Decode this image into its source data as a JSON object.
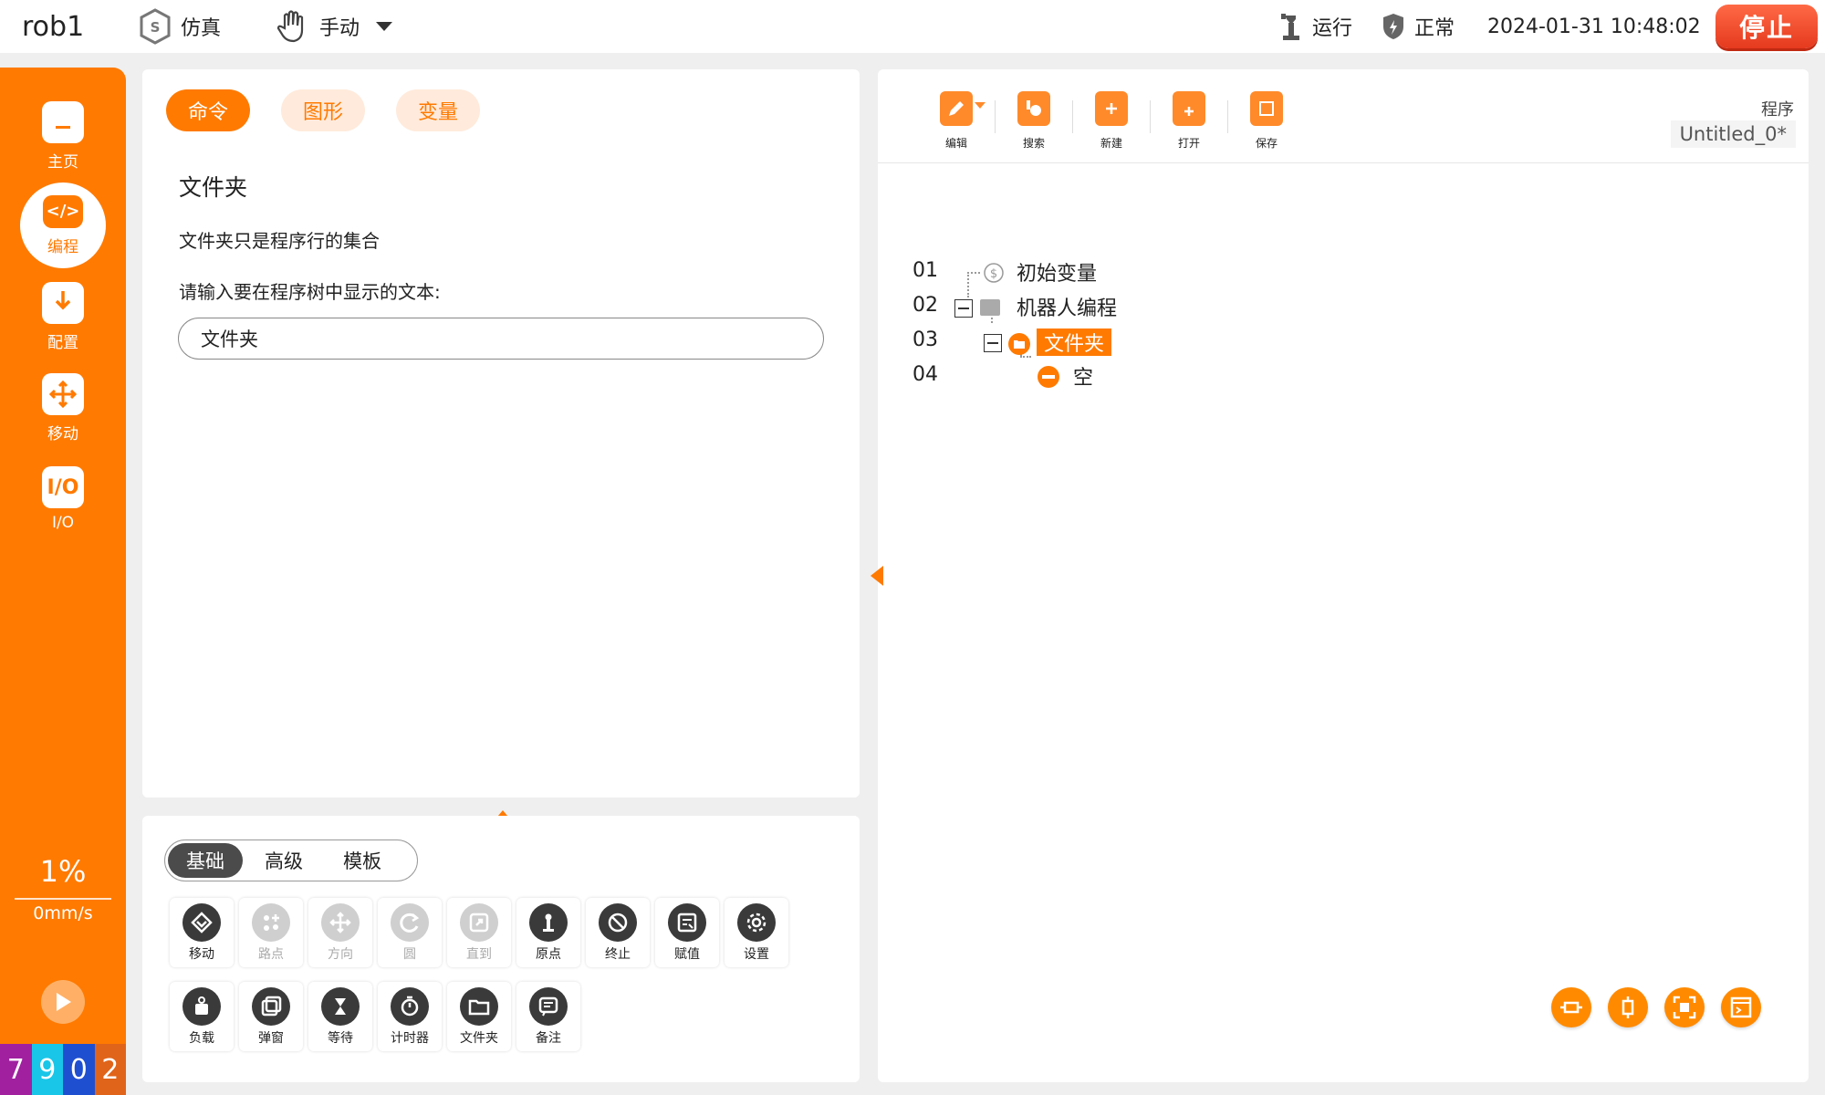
{
  "topbar": {
    "robot_name": "rob1",
    "mode_label": "仿真",
    "control_label": "手动",
    "run_label": "运行",
    "status_label": "正常",
    "datetime": "2024-01-31 10:48:02",
    "stop_label": "停止"
  },
  "sidebar": {
    "items": [
      {
        "label": "主页",
        "icon": "home-icon"
      },
      {
        "label": "编程",
        "icon": "code-icon"
      },
      {
        "label": "配置",
        "icon": "download-book-icon"
      },
      {
        "label": "移动",
        "icon": "move-arrows-icon"
      },
      {
        "label": "I/O",
        "icon": "io-icon"
      }
    ],
    "active": "编程",
    "speed_percent": "1%",
    "speed_value": "0mm/s",
    "digits": [
      "7",
      "9",
      "0",
      "2"
    ],
    "digit_colors": [
      "#a020a0",
      "#19c6e8",
      "#1f4fd1",
      "#e0641a"
    ]
  },
  "command_panel": {
    "tabs": [
      "命令",
      "图形",
      "变量"
    ],
    "active_tab": "命令",
    "title": "文件夹",
    "description": "文件夹只是程序行的集合",
    "prompt": "请输入要在程序树中显示的文本:",
    "input_value": "文件夹"
  },
  "palette": {
    "segments": [
      "基础",
      "高级",
      "模板"
    ],
    "active_segment": "基础",
    "row1": [
      {
        "label": "移动",
        "disabled": false
      },
      {
        "label": "路点",
        "disabled": true
      },
      {
        "label": "方向",
        "disabled": true
      },
      {
        "label": "圆",
        "disabled": true
      },
      {
        "label": "直到",
        "disabled": true
      },
      {
        "label": "原点",
        "disabled": false
      },
      {
        "label": "终止",
        "disabled": false
      },
      {
        "label": "赋值",
        "disabled": false
      },
      {
        "label": "设置",
        "disabled": false
      }
    ],
    "row2": [
      {
        "label": "负载",
        "disabled": false
      },
      {
        "label": "弹窗",
        "disabled": false
      },
      {
        "label": "等待",
        "disabled": false
      },
      {
        "label": "计时器",
        "disabled": false
      },
      {
        "label": "文件夹",
        "disabled": false
      },
      {
        "label": "备注",
        "disabled": false
      }
    ]
  },
  "program_panel": {
    "toolbar": [
      {
        "label": "编辑",
        "icon": "edit-icon"
      },
      {
        "label": "搜索",
        "icon": "search-icon"
      },
      {
        "label": "新建",
        "icon": "new-file-icon"
      },
      {
        "label": "打开",
        "icon": "open-folder-icon"
      },
      {
        "label": "保存",
        "icon": "save-icon"
      }
    ],
    "program_label": "程序",
    "program_name": "Untitled_0*",
    "tree": [
      {
        "line": "01",
        "label": "初始变量"
      },
      {
        "line": "02",
        "label": "机器人编程"
      },
      {
        "line": "03",
        "label": "文件夹"
      },
      {
        "line": "04",
        "label": "空"
      }
    ],
    "selected_line": "03"
  },
  "colors": {
    "accent": "#ff7a00",
    "stop": "#e53a1e",
    "dark_icon": "#3a3a3a"
  }
}
